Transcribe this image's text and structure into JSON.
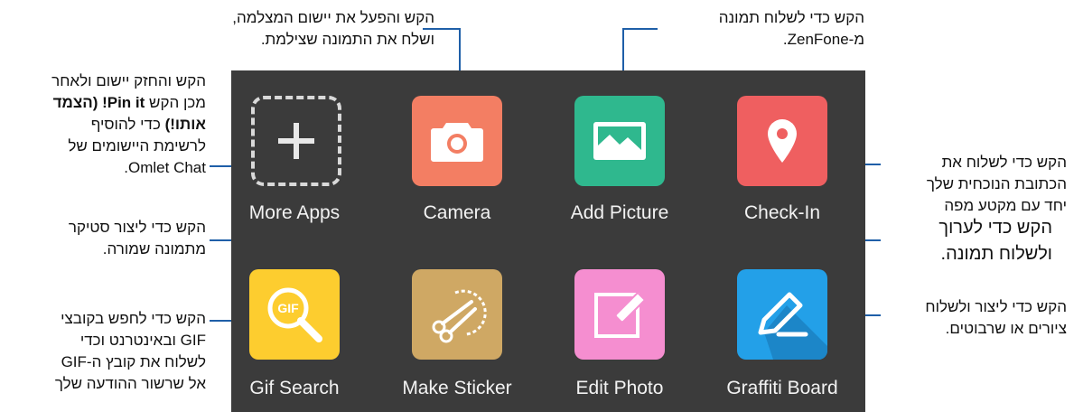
{
  "apps": [
    {
      "label": "More Apps",
      "icon": "plus-icon",
      "color": "#3b3b3b"
    },
    {
      "label": "Camera",
      "icon": "camera-icon",
      "color": "#f37e63"
    },
    {
      "label": "Add Picture",
      "icon": "image-icon",
      "color": "#2fb88e"
    },
    {
      "label": "Check-In",
      "icon": "map-pin-icon",
      "color": "#ef5f60"
    },
    {
      "label": "Gif Search",
      "icon": "gif-search-icon",
      "color": "#fdcd2f"
    },
    {
      "label": "Make Sticker",
      "icon": "scissors-icon",
      "color": "#cfa864"
    },
    {
      "label": "Edit Photo",
      "icon": "pencil-edit-icon",
      "color": "#f58ed0"
    },
    {
      "label": "Graffiti Board",
      "icon": "pen-draw-icon",
      "color": "#23a0e8"
    }
  ],
  "callouts": {
    "camera": {
      "line1": "הקש והפעל את יישום המצלמה,",
      "line2": "ושלח את התמונה שצילמת."
    },
    "add_picture": {
      "line1": "הקש כדי לשלוח תמונה",
      "line2": "מ-ZenFone."
    },
    "more_apps": {
      "line1": "הקש והחזק יישום ולאחר",
      "line2_a": "מכן הקש ",
      "line2_b": "Pin it! (הצמד",
      "line3_b": "אותו!)",
      "line3_a": " כדי להוסיף",
      "line4": "לרשימת היישומים של",
      "line5": "Omlet Chat."
    },
    "check_in": {
      "line1": "הקש כדי לשלוח את",
      "line2": "הכתובת הנוכחית שלך",
      "line3": "יחד עם מקטע מפה"
    },
    "make_sticker": {
      "line1": "הקש כדי ליצור סטיקר",
      "line2": "מתמונה שמורה."
    },
    "edit_photo": {
      "line1": "הקש כדי לערוך",
      "line2": "ולשלוח תמונה."
    },
    "gif_search": {
      "line1": "הקש כדי לחפש בקובצי",
      "line2": "GIF ובאינטרנט וכדי",
      "line3": "לשלוח את קובץ ה-GIF",
      "line4": "אל שרשור ההודעה שלך"
    },
    "graffiti": {
      "line1": "הקש כדי ליצור ולשלוח",
      "line2": "ציורים או שרבוטים."
    }
  },
  "gif_text": "GIF",
  "colors": {
    "panel": "#3b3b3b",
    "callout_line": "#1f5fa8",
    "label": "#f2f2f2"
  }
}
